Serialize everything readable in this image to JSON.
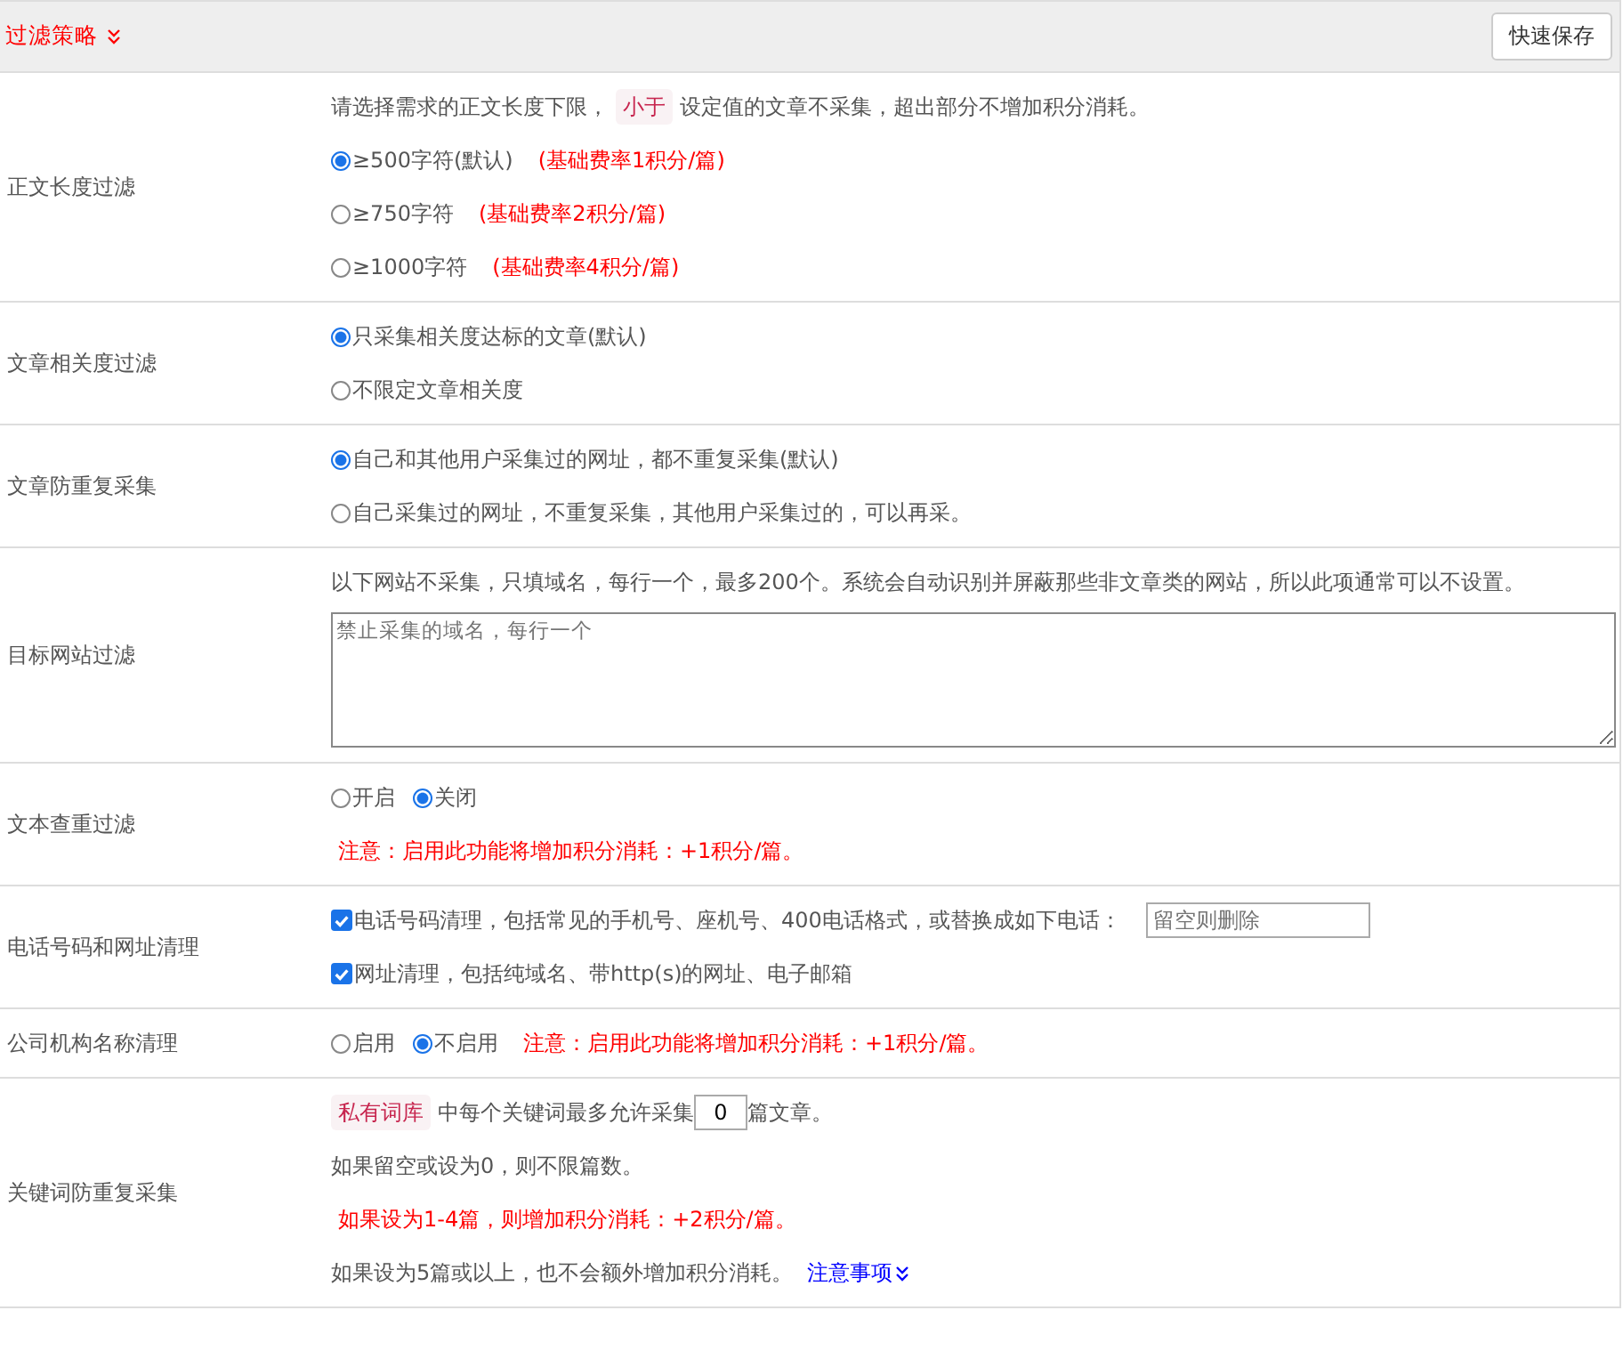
{
  "header": {
    "title": "过滤策略",
    "save_button": "快速保存"
  },
  "rows": [
    {
      "label": "正文长度过滤",
      "lines": [
        [
          {
            "kind": "text",
            "text": "请选择需求的正文长度下限，"
          },
          {
            "kind": "tag",
            "text": "小于"
          },
          {
            "kind": "text",
            "text": "设定值的文章不采集，超出部分不增加积分消耗。"
          }
        ],
        [
          {
            "kind": "radio",
            "text": "≥500字符(默认)",
            "selected": true
          },
          {
            "kind": "note",
            "text": "(基础费率1积分/篇)"
          }
        ],
        [
          {
            "kind": "radio",
            "text": "≥750字符",
            "selected": false
          },
          {
            "kind": "note",
            "text": "(基础费率2积分/篇)"
          }
        ],
        [
          {
            "kind": "radio",
            "text": "≥1000字符",
            "selected": false
          },
          {
            "kind": "note",
            "text": "(基础费率4积分/篇)"
          }
        ]
      ]
    },
    {
      "label": "文章相关度过滤",
      "lines": [
        [
          {
            "kind": "radio",
            "text": "只采集相关度达标的文章(默认)",
            "selected": true
          }
        ],
        [
          {
            "kind": "radio",
            "text": "不限定文章相关度",
            "selected": false
          }
        ]
      ]
    },
    {
      "label": "文章防重复采集",
      "lines": [
        [
          {
            "kind": "radio",
            "text": "自己和其他用户采集过的网址，都不重复采集(默认)",
            "selected": true
          }
        ],
        [
          {
            "kind": "radio",
            "text": "自己采集过的网址，不重复采集，其他用户采集过的，可以再采。",
            "selected": false
          }
        ]
      ]
    },
    {
      "label": "目标网站过滤",
      "lines": [
        [
          {
            "kind": "text",
            "text": "以下网站不采集，只填域名，每行一个，最多200个。系统会自动识别并屏蔽那些非文章类的网站，所以此项通常可以不设置。"
          }
        ],
        [
          {
            "kind": "textarea",
            "placeholder": "禁止采集的域名，每行一个"
          }
        ]
      ]
    },
    {
      "label": "文本查重过滤",
      "lines": [
        [
          {
            "kind": "radio",
            "text": "开启",
            "selected": false
          },
          {
            "kind": "radio",
            "text": "关闭",
            "selected": true
          }
        ],
        [
          {
            "kind": "note",
            "text": "注意：启用此功能将增加积分消耗：+1积分/篇。"
          }
        ]
      ]
    },
    {
      "label": "电话号码和网址清理",
      "lines": [
        [
          {
            "kind": "checkbox",
            "text": "电话号码清理，包括常见的手机号、座机号、400电话格式，或替换成如下电话：",
            "checked": true
          },
          {
            "kind": "input",
            "placeholder": "留空则删除"
          }
        ],
        [
          {
            "kind": "checkbox",
            "text": "网址清理，包括纯域名、带http(s)的网址、电子邮箱",
            "checked": true
          }
        ]
      ]
    },
    {
      "label": "公司机构名称清理",
      "lines": [
        [
          {
            "kind": "radio",
            "text": "启用",
            "selected": false
          },
          {
            "kind": "radio",
            "text": "不启用",
            "selected": true
          },
          {
            "kind": "note",
            "text": "注意：启用此功能将增加积分消耗：+1积分/篇。"
          }
        ]
      ]
    },
    {
      "label": "关键词防重复采集",
      "lines": [
        [
          {
            "kind": "tag",
            "text": "私有词库"
          },
          {
            "kind": "text",
            "text": "中每个关键词最多允许采集"
          },
          {
            "kind": "number",
            "value": "0"
          },
          {
            "kind": "text",
            "text": "篇文章。"
          }
        ],
        [
          {
            "kind": "text",
            "text": "如果留空或设为0，则不限篇数。"
          }
        ],
        [
          {
            "kind": "note",
            "text": "如果设为1-4篇，则增加积分消耗：+2积分/篇。"
          }
        ],
        [
          {
            "kind": "text",
            "text": "如果设为5篇或以上，也不会额外增加积分消耗。"
          },
          {
            "kind": "link",
            "text": "注意事项"
          }
        ]
      ]
    }
  ]
}
